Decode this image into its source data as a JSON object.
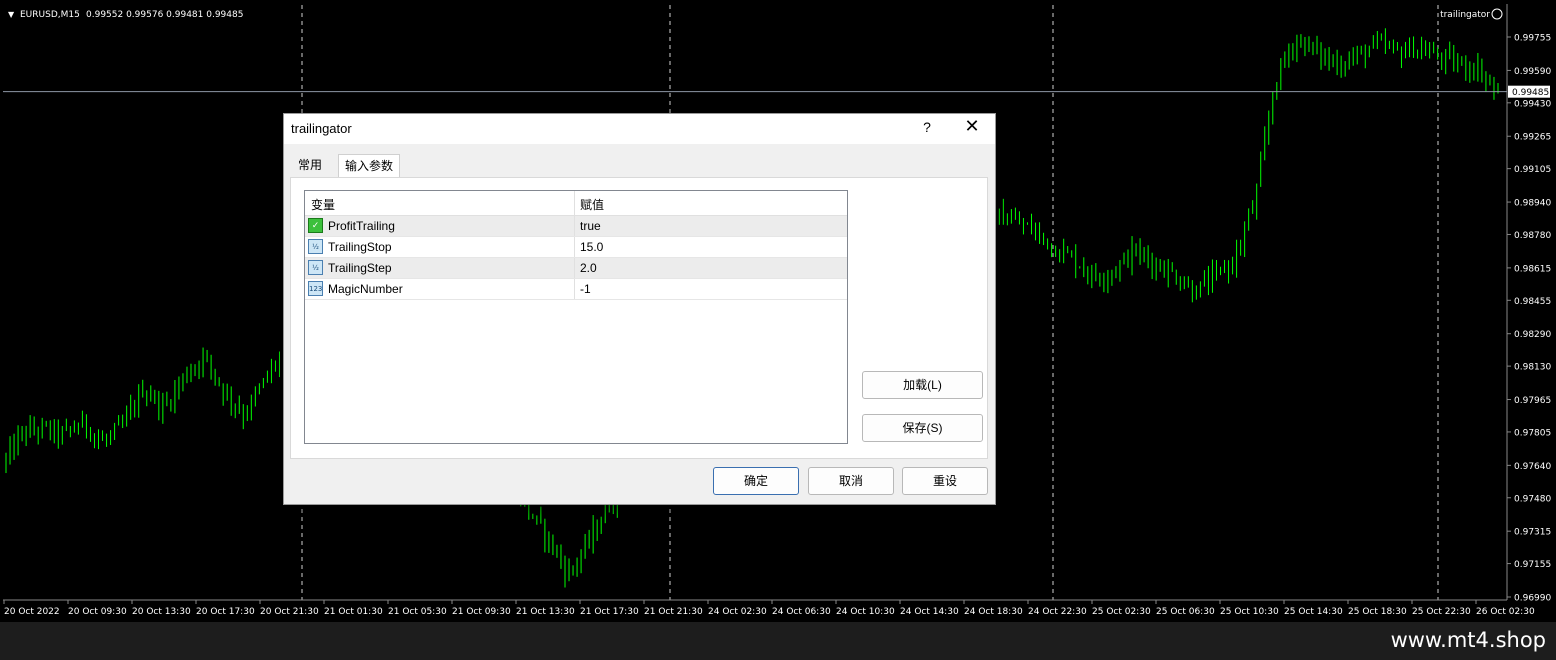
{
  "chart_data": {
    "type": "candlestick",
    "symbol_label": "EURUSD,M15",
    "ohlc_label": "0.99552 0.99576 0.99481 0.99485",
    "ea_label": "trailingator",
    "ylim": [
      0.9699,
      0.9785
    ],
    "y_ticks": [
      "0.99755",
      "0.99590",
      "0.99430",
      "0.99265",
      "0.99105",
      "0.98940",
      "0.98780",
      "0.98615",
      "0.98455",
      "0.98290",
      "0.98130",
      "0.97965",
      "0.97805",
      "0.97640",
      "0.97480",
      "0.97315",
      "0.97155",
      "0.96990"
    ],
    "current_price": "0.99485",
    "x_ticks": [
      "20 Oct 2022",
      "20 Oct 09:30",
      "20 Oct 13:30",
      "20 Oct 17:30",
      "20 Oct 21:30",
      "21 Oct 01:30",
      "21 Oct 05:30",
      "21 Oct 09:30",
      "21 Oct 13:30",
      "21 Oct 17:30",
      "21 Oct 21:30",
      "24 Oct 02:30",
      "24 Oct 06:30",
      "24 Oct 10:30",
      "24 Oct 14:30",
      "24 Oct 18:30",
      "24 Oct 22:30",
      "25 Oct 02:30",
      "25 Oct 06:30",
      "25 Oct 10:30",
      "25 Oct 14:30",
      "25 Oct 18:30",
      "25 Oct 22:30",
      "26 Oct 02:30"
    ],
    "path": [
      0.9764,
      0.978,
      0.9782,
      0.9779,
      0.9785,
      0.9775,
      0.9784,
      0.9802,
      0.9792,
      0.9808,
      0.9818,
      0.98,
      0.9789,
      0.9806,
      0.9822,
      0.981,
      0.9796,
      0.9788,
      0.9781,
      0.9784,
      0.9786,
      0.9788,
      0.9781,
      0.9775,
      0.977,
      0.9758,
      0.9742,
      0.9728,
      0.971,
      0.9726,
      0.9744,
      0.976,
      0.9774,
      0.9786,
      0.98,
      0.982,
      0.984,
      0.986,
      0.9872,
      0.988,
      0.9876,
      0.9872,
      0.9871,
      0.9868,
      0.9882,
      0.989,
      0.9894,
      0.9887,
      0.988,
      0.9888,
      0.9885,
      0.988,
      0.9872,
      0.9866,
      0.9857,
      0.986,
      0.987,
      0.9864,
      0.9858,
      0.985,
      0.9857,
      0.9866,
      0.9896,
      0.9955,
      0.9975,
      0.9968,
      0.9962,
      0.9966,
      0.9972,
      0.9968,
      0.997,
      0.9966,
      0.9962,
      0.996,
      0.9948
    ]
  },
  "watermark": "www.mt4.shop",
  "dialog": {
    "title": "trailingator",
    "help": "?",
    "close": "✕",
    "tabs": [
      "常用",
      "输入参数"
    ],
    "columns": [
      "变量",
      "赋值"
    ],
    "params": [
      {
        "icon": "bool-icon",
        "name": "ProfitTrailing",
        "value": "true"
      },
      {
        "icon": "double-icon",
        "name": "TrailingStop",
        "value": "15.0"
      },
      {
        "icon": "double-icon",
        "name": "TrailingStep",
        "value": "2.0"
      },
      {
        "icon": "int-icon",
        "name": "MagicNumber",
        "value": "-1"
      }
    ],
    "load_label": "加载(L)",
    "save_label": "保存(S)",
    "ok_label": "确定",
    "cancel_label": "取消",
    "reset_label": "重设"
  }
}
